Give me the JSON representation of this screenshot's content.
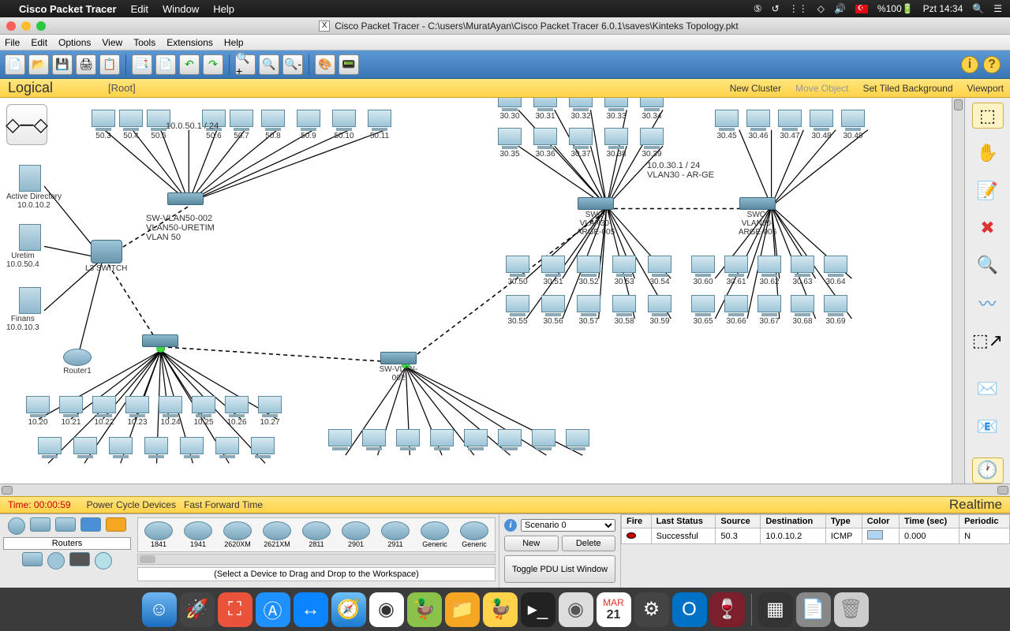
{
  "macos": {
    "app_name": "Cisco Packet Tracer",
    "menus": [
      "Edit",
      "Window",
      "Help"
    ],
    "battery": "%100",
    "clock": "Pzt 14:34"
  },
  "window": {
    "title": "Cisco Packet Tracer - C:\\users\\MuratAyan\\Cisco Packet Tracer 6.0.1\\saves\\Kinteks Topology.pkt"
  },
  "app_menu": [
    "File",
    "Edit",
    "Options",
    "View",
    "Tools",
    "Extensions",
    "Help"
  ],
  "logical_bar": {
    "mode": "Logical",
    "root": "[Root]",
    "new_cluster": "New Cluster",
    "move_object": "Move Object",
    "set_bg": "Set Tiled Background",
    "viewport": "Viewport"
  },
  "time_bar": {
    "time": "Time: 00:00:59",
    "power": "Power Cycle Devices",
    "fast": "Fast Forward Time",
    "realtime": "Realtime"
  },
  "device_category": "Routers",
  "device_models": [
    "1841",
    "1941",
    "2620XM",
    "2621XM",
    "2811",
    "2901",
    "2911",
    "Generic",
    "Generic"
  ],
  "device_hint": "(Select a Device to Drag and Drop to the Workspace)",
  "scenario": {
    "label": "Scenario 0",
    "new": "New",
    "delete": "Delete",
    "toggle": "Toggle PDU List Window"
  },
  "pdu": {
    "headers": [
      "Fire",
      "Last Status",
      "Source",
      "Destination",
      "Type",
      "Color",
      "Time (sec)",
      "Periodic"
    ],
    "row": {
      "status": "Successful",
      "source": "50.3",
      "dest": "10.0.10.2",
      "type": "ICMP",
      "time": "0.000",
      "periodic": "N"
    }
  },
  "topology": {
    "vlan50_subnet": "10.0.50.1 / 24",
    "sw_vlan50": "SW-VLAN50-002",
    "vlan50_desc": "VLAN50-URETIM",
    "vlan50_name": "VLAN 50",
    "vlan30_subnet": "10.0.30.1 / 24",
    "vlan30_desc": "VLAN30 - AR-GE",
    "swc_005": "SWC-VLAN30-ARGE-005",
    "swc_006": "SWC-VLAN30-ARGE-006",
    "sw_vlan_002": "SW-VLAN-002",
    "l3": "L3 SWITCH",
    "ad": "Active Directory",
    "ad_ip": "10.0.10.2",
    "uretim": "Uretim",
    "uretim_ip": "10.0.50.4",
    "finans": "Finans",
    "finans_ip": "10.0.10.3",
    "router1": "Router1",
    "pcs_50": [
      "50.3",
      "50.4",
      "50.5",
      "50.6",
      "50.7",
      "50.8",
      "50.9",
      "50.10",
      "50.11"
    ],
    "pcs_30a": [
      "30.30",
      "30.31",
      "30.32",
      "30.33",
      "30.34"
    ],
    "pcs_30b": [
      "30.35",
      "30.36",
      "30.37",
      "30.38",
      "30.39"
    ],
    "pcs_30c": [
      "30.45",
      "30.46",
      "30.47",
      "30.48",
      "30.49"
    ],
    "pcs_30d": [
      "30.50",
      "30.51",
      "30.52",
      "30.53",
      "30.54"
    ],
    "pcs_30e": [
      "30.55",
      "30.56",
      "30.57",
      "30.58",
      "30.59"
    ],
    "pcs_30f": [
      "30.60",
      "30.61",
      "30.62",
      "30.63",
      "30.64"
    ],
    "pcs_30g": [
      "30.65",
      "30.66",
      "30.67",
      "30.68",
      "30.69"
    ],
    "pcs_10": [
      "10.20",
      "10.21",
      "10.22",
      "10.23",
      "10.24",
      "10.25",
      "10.26",
      "10.27"
    ]
  }
}
